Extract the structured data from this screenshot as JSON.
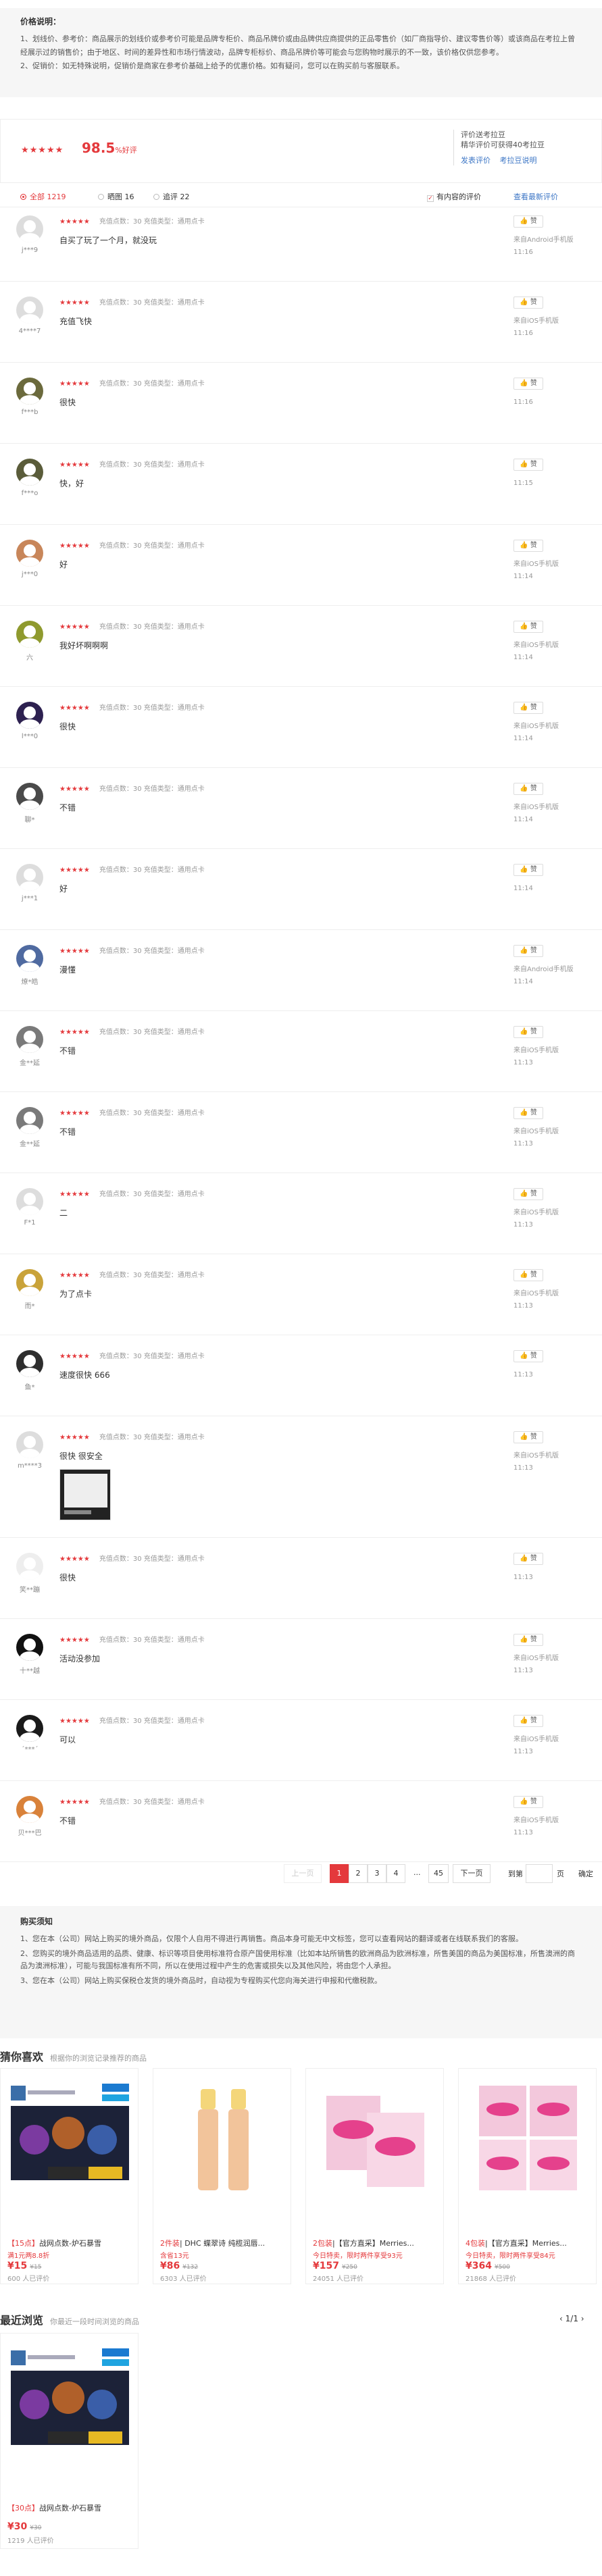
{
  "price_note": {
    "title": "价格说明：",
    "line1": "1、划线价、参考价：商品展示的划线价或参考价可能是品牌专柜价、商品吊牌价或由品牌供应商提供的正品零售价（如厂商指导价、建议零售价等）或该商品在考拉上曾经展示过的销售价；由于地区、时间的差异性和市场行情波动，品牌专柜标价、商品吊牌价等可能会与您购物时展示的不一致，该价格仅供您参考。",
    "line2": "2、促销价：如无特殊说明，促销价是商家在参考价基础上给予的优惠价格。如有疑问，您可以在购买前与客服联系。"
  },
  "summary": {
    "stars": "★★★★★",
    "rate": "98.5",
    "rate_unit": "%好评",
    "line1": "评价送考拉豆",
    "line2": "精华评价可获得40考拉豆",
    "link1": "发表评价",
    "link2": "考拉豆说明"
  },
  "tabs": {
    "all": "全部 1219",
    "pic": "晒图 16",
    "add": "追评 22",
    "has_content": "有内容的评价",
    "sort_new": "查看最新评价"
  },
  "reviews": [
    {
      "user": "j***9",
      "stars": "★★★★★",
      "meta": "充值点数：30   充值类型：通用点卡",
      "content": "自买了玩了一个月，就没玩",
      "device": "来自Android手机版",
      "time": "11:16",
      "like": "赞",
      "avatar": "#ddd"
    },
    {
      "user": "4****7",
      "stars": "★★★★★",
      "meta": "充值点数：30   充值类型：通用点卡",
      "content": "充值飞快",
      "device": "来自iOS手机版",
      "time": "11:16",
      "like": "赞",
      "avatar": "#ddd"
    },
    {
      "user": "f***b",
      "stars": "★★★★★",
      "meta": "充值点数：30   充值类型：通用点卡",
      "content": "很快",
      "device": "",
      "time": "11:16",
      "like": "赞",
      "avatar": "#6b6a3c"
    },
    {
      "user": "f***o",
      "stars": "★★★★★",
      "meta": "充值点数：30   充值类型：通用点卡",
      "content": "快，好",
      "device": "",
      "time": "11:15",
      "like": "赞",
      "avatar": "#5a5c3a"
    },
    {
      "user": "j***0",
      "stars": "★★★★★",
      "meta": "充值点数：30   充值类型：通用点卡",
      "content": "好",
      "device": "来自iOS手机版",
      "time": "11:14",
      "like": "赞",
      "avatar": "#c8865a"
    },
    {
      "user": "六",
      "stars": "★★★★★",
      "meta": "充值点数：30   充值类型：通用点卡",
      "content": "我好坏啊啊啊",
      "device": "来自iOS手机版",
      "time": "11:14",
      "like": "赞",
      "avatar": "#8f9a2e"
    },
    {
      "user": "l***0",
      "stars": "★★★★★",
      "meta": "充值点数：30   充值类型：通用点卡",
      "content": "很快",
      "device": "来自iOS手机版",
      "time": "11:14",
      "like": "赞",
      "avatar": "#2d2150"
    },
    {
      "user": "聊*",
      "stars": "★★★★★",
      "meta": "充值点数：30   充值类型：通用点卡",
      "content": "不错",
      "device": "来自iOS手机版",
      "time": "11:14",
      "like": "赞",
      "avatar": "#4a4a4a"
    },
    {
      "user": "j***1",
      "stars": "★★★★★",
      "meta": "充值点数：30   充值类型：通用点卡",
      "content": "好",
      "device": "",
      "time": "11:14",
      "like": "赞",
      "avatar": "#ddd"
    },
    {
      "user": "燎*皓",
      "stars": "★★★★★",
      "meta": "充值点数：30   充值类型：通用点卡",
      "content": "漫懂",
      "device": "来自Android手机版",
      "time": "11:14",
      "like": "赞",
      "avatar": "#4f6aa0"
    },
    {
      "user": "金**延",
      "stars": "★★★★★",
      "meta": "充值点数：30   充值类型：通用点卡",
      "content": "不错",
      "device": "来自iOS手机版",
      "time": "11:13",
      "like": "赞",
      "avatar": "#7a7a7a"
    },
    {
      "user": "金**延",
      "stars": "★★★★★",
      "meta": "充值点数：30   充值类型：通用点卡",
      "content": "不错",
      "device": "来自iOS手机版",
      "time": "11:13",
      "like": "赞",
      "avatar": "#7a7a7a"
    },
    {
      "user": "F*1",
      "stars": "★★★★★",
      "meta": "充值点数：30   充值类型：通用点卡",
      "content": "二",
      "device": "来自iOS手机版",
      "time": "11:13",
      "like": "赞",
      "avatar": "#ddd"
    },
    {
      "user": "而*",
      "stars": "★★★★★",
      "meta": "充值点数：30   充值类型：通用点卡",
      "content": "为了点卡",
      "device": "来自iOS手机版",
      "time": "11:13",
      "like": "赞",
      "avatar": "#c9a33a"
    },
    {
      "user": "鱼*",
      "stars": "★★★★★",
      "meta": "充值点数：30   充值类型：通用点卡",
      "content": "速度很快 666",
      "device": "",
      "time": "11:13",
      "like": "赞",
      "avatar": "#2e2e2e"
    },
    {
      "user": "m****3",
      "stars": "★★★★★",
      "meta": "充值点数：30   充值类型：通用点卡",
      "content": "很快 很安全",
      "device": "来自iOS手机版",
      "time": "11:13",
      "like": "赞",
      "avatar": "#ddd",
      "has_image": true
    },
    {
      "user": "笑**蹦",
      "stars": "★★★★★",
      "meta": "充值点数：30   充值类型：通用点卡",
      "content": "很快",
      "device": "",
      "time": "11:13",
      "like": "赞",
      "avatar": "#eee"
    },
    {
      "user": "十**越",
      "stars": "★★★★★",
      "meta": "充值点数：30   充值类型：通用点卡",
      "content": "活动没参加",
      "device": "来自iOS手机版",
      "time": "11:13",
      "like": "赞",
      "avatar": "#111"
    },
    {
      "user": "ˊ***ˊ",
      "stars": "★★★★★",
      "meta": "充值点数：30   充值类型：通用点卡",
      "content": "可以",
      "device": "来自iOS手机版",
      "time": "11:13",
      "like": "赞",
      "avatar": "#1a1a1a"
    },
    {
      "user": "贝***巴",
      "stars": "★★★★★",
      "meta": "充值点数：30   充值类型：通用点卡",
      "content": "不错",
      "device": "来自iOS手机版",
      "time": "11:13",
      "like": "赞",
      "avatar": "#d9823a"
    }
  ],
  "pager": {
    "prev": "上一页",
    "p1": "1",
    "p2": "2",
    "p3": "3",
    "p4": "4",
    "dots": "...",
    "last": "45",
    "next": "下一页",
    "goto": "到第",
    "page_unit": "页",
    "ok": "确定"
  },
  "notice": {
    "title": "购买须知",
    "l1": "1、您在本（公司）网站上购买的境外商品，仅限个人自用不得进行再销售。商品本身可能无中文标签，您可以查看网站的翻译或者在线联系我们的客服。",
    "l2": "2、您购买的境外商品适用的品质、健康、标识等项目使用标准符合原产国使用标准（比如本站所销售的欧洲商品为欧洲标准，所售美国的商品为美国标准，所售澳洲的商品为澳洲标准），可能与我国标准有所不同，所以在使用过程中产生的危害或损失以及其他风险，将由您个人承担。",
    "l3": "3、您在本（公司）网站上购买保税仓发货的境外商品时，自动视为专程购买代您向海关进行申报和代缴税款。"
  },
  "guess": {
    "title": "猜你喜欢",
    "sub": "根据你的浏览记录推荐的商品",
    "items": [
      {
        "tag": "【15点】",
        "name": "战网点数-炉石暴雪",
        "promo": "满1元两8.8折",
        "price": "¥15",
        "orig": "¥15",
        "count": "600 人已评价"
      },
      {
        "tag": "2件装",
        "name": "| DHC 蝶翠诗 纯榄润唇...",
        "promo": "含省13元",
        "price": "¥86",
        "orig": "¥132",
        "count": "6303 人已评价"
      },
      {
        "tag": "2包装",
        "name": "|【官方直采】Merries...",
        "promo": "今日特卖，限时两件享受93元",
        "price": "¥157",
        "orig": "¥250",
        "count": "24051 人已评价"
      },
      {
        "tag": "4包装",
        "name": "|【官方直采】Merries...",
        "promo": "今日特卖，限时两件享受84元",
        "price": "¥364",
        "orig": "¥500",
        "count": "21868 人已评价"
      }
    ]
  },
  "recent": {
    "title": "最近浏览",
    "sub": "你最近一段时间浏览的商品",
    "pages": "1/1",
    "item": {
      "tag": "【30点】",
      "name": "战网点数-炉石暴雪",
      "price": "¥30",
      "orig": "¥30",
      "count": "1219 人已评价"
    }
  }
}
